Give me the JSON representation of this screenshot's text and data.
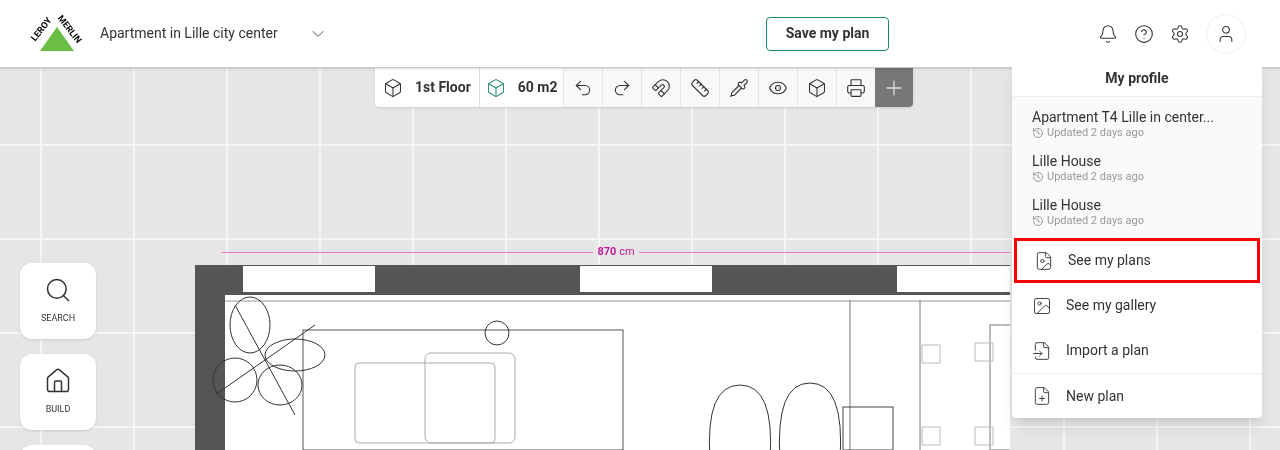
{
  "header": {
    "logo_text": [
      "LEROY",
      "MERLIN"
    ],
    "project_title": "Apartment in Lille city center",
    "save_button": "Save my plan"
  },
  "toolbar": {
    "floor": "1st Floor",
    "area": "60 m2"
  },
  "side_tools": [
    {
      "label": "SEARCH",
      "kind": "search"
    },
    {
      "label": "BUILD",
      "kind": "build"
    },
    {
      "kind": "blank"
    }
  ],
  "plan": {
    "dimension": "**870** cm"
  },
  "profile_menu": {
    "title": "My profile",
    "recent_plans": [
      {
        "name": "Apartment T4 Lille in center...",
        "updated": "Updated 2 days ago"
      },
      {
        "name": "Lille House",
        "updated": "Updated 2 days ago"
      },
      {
        "name": "Lille House",
        "updated": "Updated 2 days ago"
      }
    ],
    "actions": [
      {
        "label": "See my plans",
        "kind": "plans",
        "highlighted": true
      },
      {
        "label": "See my gallery",
        "kind": "gallery",
        "highlighted": false
      },
      {
        "label": "Import a plan",
        "kind": "import",
        "highlighted": false
      },
      {
        "label": "New plan",
        "kind": "new",
        "highlighted": false
      }
    ]
  }
}
